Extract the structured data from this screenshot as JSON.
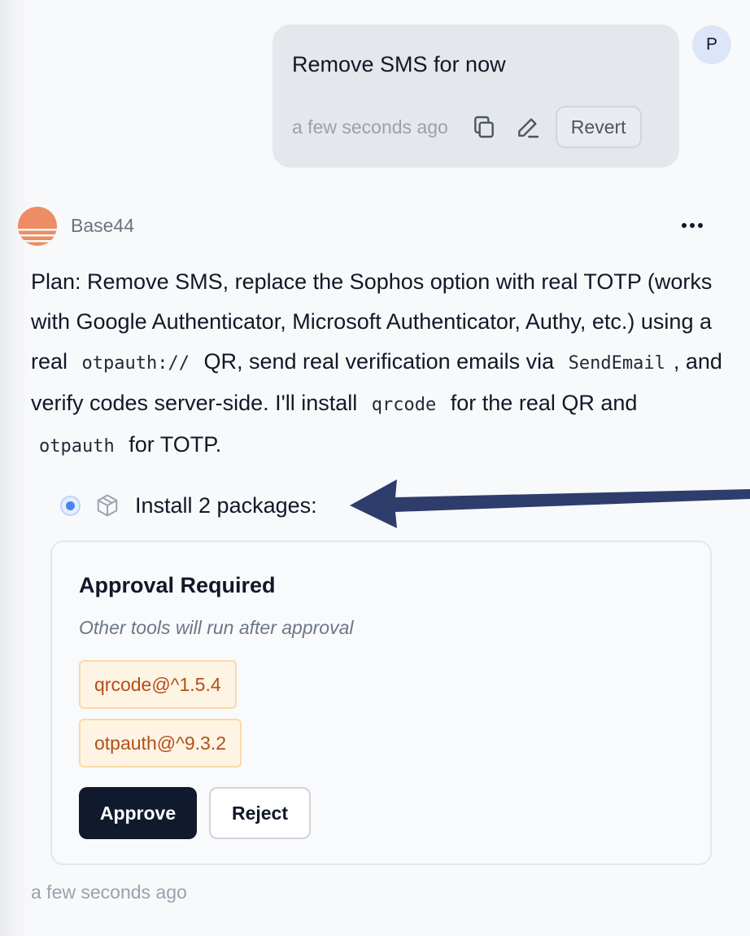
{
  "user_message": {
    "avatar_initial": "P",
    "text": "Remove SMS for now",
    "timestamp": "a few seconds ago",
    "icons": [
      "copy-icon",
      "edit-icon"
    ],
    "revert_label": "Revert"
  },
  "assistant": {
    "name": "Base44",
    "logo_color": "#ec8d63",
    "plan": {
      "p1": "Plan: Remove SMS, replace the Sophos option with real TOTP (works with Google Authenticator, Microsoft Authenticator, Authy, etc.) using a real ",
      "c1": "otpauth://",
      "p2": " QR, send real verification emails via ",
      "c2": "SendEmail",
      "p3": ", and verify codes server-side. I'll install ",
      "c3": "qrcode",
      "p4": " for the real QR and ",
      "c4": "otpauth",
      "p5": " for TOTP."
    },
    "tool": {
      "label": "Install 2 packages:",
      "icon": "package-icon"
    },
    "approval": {
      "title": "Approval Required",
      "subtitle": "Other tools will run after approval",
      "packages": [
        "qrcode@^1.5.4",
        "otpauth@^9.3.2"
      ],
      "approve_label": "Approve",
      "reject_label": "Reject"
    },
    "timestamp": "a few seconds ago"
  },
  "colors": {
    "arrow": "#2e3d6b",
    "chip_text": "#b54e18",
    "approve_bg": "#111a2c"
  }
}
